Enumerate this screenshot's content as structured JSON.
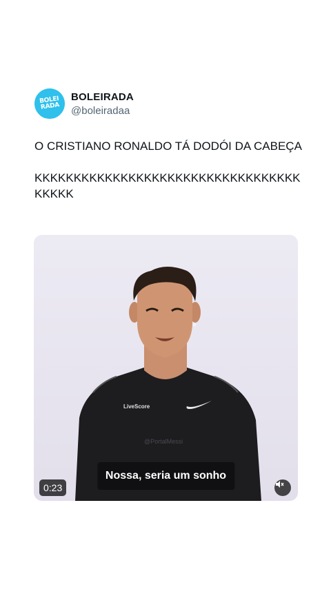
{
  "author": {
    "avatar_text_line1": "BOLEI",
    "avatar_text_line2": "RADA",
    "display_name": "BOLEIRADA",
    "handle": "@boleiradaa"
  },
  "tweet": {
    "paragraphs": [
      "O CRISTIANO RONALDO TÁ DODÓI DA CABEÇA",
      "KKKKKKKKKKKKKKKKKKKKKKKKKKKKKKKKKKKKKKK"
    ]
  },
  "video": {
    "subtitle": "Nossa, seria um sonho",
    "duration": "0:23",
    "shirt_brand": "LiveScore",
    "overlay_watermark": "@PortalMessi",
    "volume_icon": "speaker-muted-icon"
  },
  "colors": {
    "avatar_bg": "#2fc0ec",
    "handle_gray": "#536471"
  }
}
